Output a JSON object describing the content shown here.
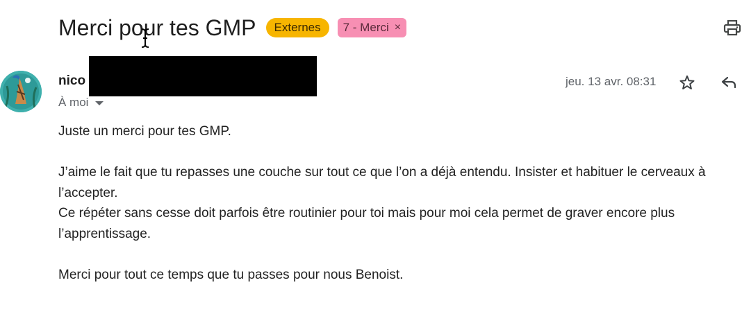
{
  "email": {
    "subject": "Merci pour tes GMP",
    "labels": [
      {
        "text": "Externes",
        "color": "#f7b500"
      },
      {
        "text": "7 - Merci",
        "color": "#f78fb3",
        "close": "×"
      }
    ],
    "sender_name": "nico",
    "recipient_line": "À moi",
    "date": "jeu. 13 avr. 08:31",
    "body": {
      "p1": "Juste un merci pour tes GMP.",
      "p2_line1": "J’aime le fait que tu repasses une couche sur tout ce que l’on a déjà entendu. Insister et habituer le cerveaux à l’accepter.",
      "p2_line2": "Ce répéter sans cesse doit parfois être routinier pour toi mais pour moi cela permet de graver encore plus l’apprentissage.",
      "p3": "Merci pour tout ce temps que tu passes pour nous Benoist."
    }
  },
  "icons": {
    "print": "print-icon",
    "star": "star-outline-icon",
    "reply": "reply-icon",
    "caret": "caret-down-icon",
    "cursor": "text-cursor-icon"
  }
}
